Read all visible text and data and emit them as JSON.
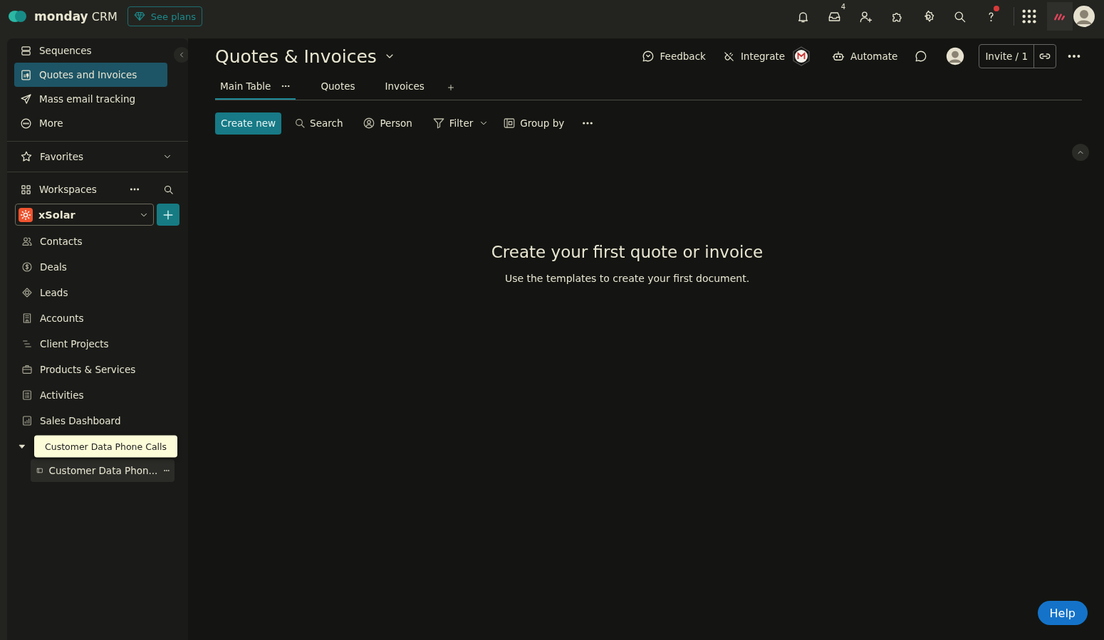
{
  "topbar": {
    "brand": "monday",
    "product": "CRM",
    "see_plans": "See plans",
    "inbox_badge": "4"
  },
  "sidebar": {
    "top_items": [
      {
        "label": "Sequences",
        "selected": false
      },
      {
        "label": "Quotes and Invoices",
        "selected": true
      },
      {
        "label": "Mass email tracking",
        "selected": false
      },
      {
        "label": "More",
        "selected": false
      }
    ],
    "favorites": {
      "label": "Favorites",
      "expanded": false
    },
    "workspaces": "Workspaces",
    "workspace": {
      "name": "xSolar"
    },
    "items": [
      {
        "label": "Contacts"
      },
      {
        "label": "Deals"
      },
      {
        "label": "Leads"
      },
      {
        "label": "Accounts"
      },
      {
        "label": "Client Projects"
      },
      {
        "label": "Products & Services"
      },
      {
        "label": "Activities"
      },
      {
        "label": "Sales Dashboard"
      }
    ],
    "folder": {
      "expanded": true,
      "children": [
        {
          "label": "Customer Data Phon..."
        }
      ]
    },
    "tooltip": "Customer Data Phone Calls"
  },
  "board": {
    "title": "Quotes & Invoices",
    "actions": {
      "feedback": "Feedback",
      "integrate": "Integrate",
      "automate": "Automate",
      "invite": "Invite / 1"
    },
    "tabs": [
      {
        "label": "Main Table",
        "selected": true
      },
      {
        "label": "Quotes",
        "selected": false
      },
      {
        "label": "Invoices",
        "selected": false
      }
    ],
    "toolbar": {
      "create_new": "Create new",
      "search": "Search",
      "person": "Person",
      "filter": "Filter",
      "group_by": "Group by"
    },
    "empty_state": {
      "heading": "Create your first quote or invoice",
      "text": "Use the templates to create your first document."
    }
  },
  "help": "Help"
}
